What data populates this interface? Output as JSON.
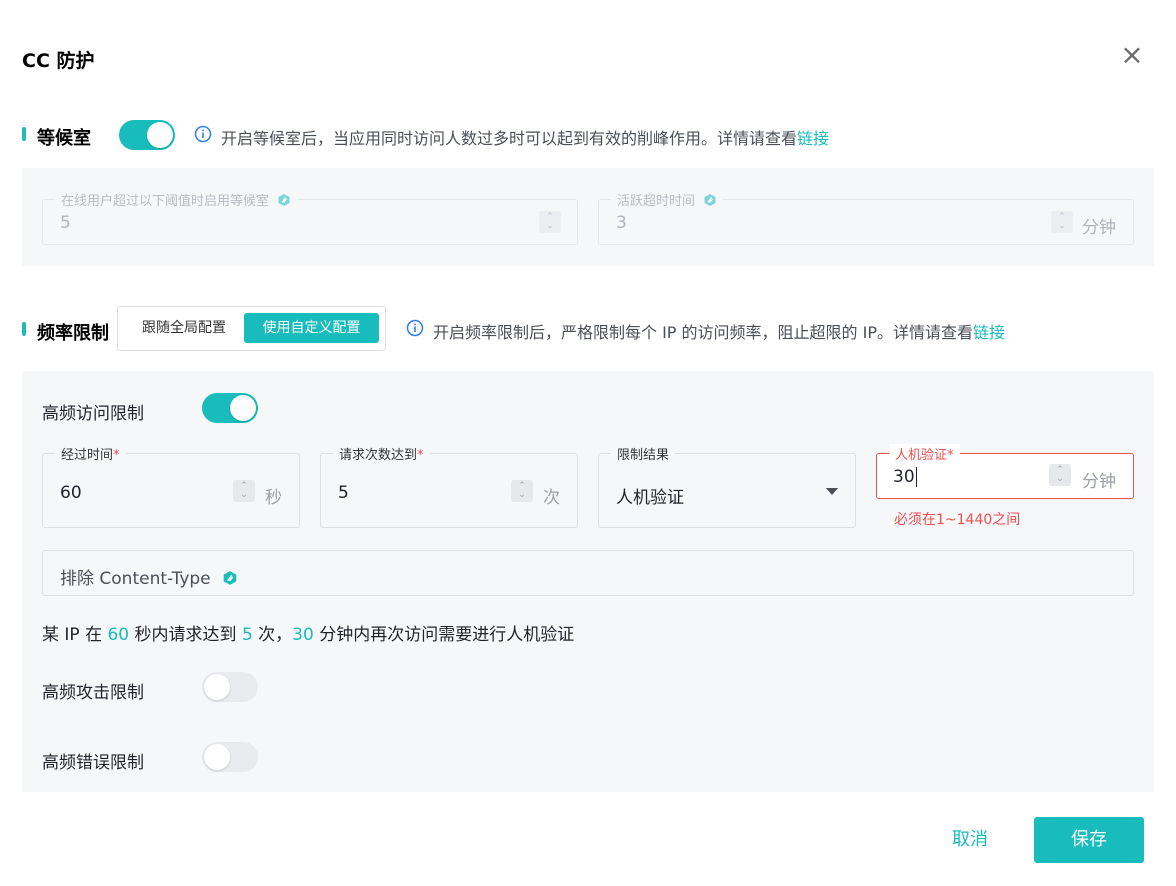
{
  "dialog": {
    "title": "CC 防护",
    "close_icon": "close-icon"
  },
  "waiting_room": {
    "title": "等候室",
    "enabled": true,
    "info_text": "开启等候室后，当应用同时访问人数过多时可以起到有效的削峰作用。详情请查看",
    "info_link": "链接",
    "threshold": {
      "label": "在线用户超过以下阈值时启用等候室",
      "value": "5",
      "disabled": true
    },
    "timeout": {
      "label": "活跃超时时间",
      "value": "3",
      "unit": "分钟",
      "disabled": true
    }
  },
  "rate_limit": {
    "title": "频率限制",
    "segments": [
      {
        "label": "跟随全局配置",
        "active": false
      },
      {
        "label": "使用自定义配置",
        "active": true
      }
    ],
    "info_text": "开启频率限制后，严格限制每个 IP 的访问频率，阻止超限的 IP。详情请查看",
    "info_link": "链接",
    "high_freq_access": {
      "label": "高频访问限制",
      "enabled": true
    },
    "fields": {
      "elapsed_time": {
        "label": "经过时间",
        "required": "*",
        "value": "60",
        "unit": "秒"
      },
      "request_count": {
        "label": "请求次数达到",
        "required": "*",
        "value": "5",
        "unit": "次"
      },
      "limit_result": {
        "label": "限制结果",
        "value": "人机验证"
      },
      "captcha": {
        "label": "人机验证",
        "required": "*",
        "value": "30",
        "unit": "分钟",
        "error": "必须在1~1440之间"
      }
    },
    "exclude_content_type": {
      "placeholder": "排除 Content-Type"
    },
    "summary": {
      "p1": "某 IP 在 ",
      "seconds": "60",
      "p2": " 秒内请求达到 ",
      "count": "5",
      "p3": " 次，",
      "minutes": "30",
      "p4": " 分钟内再次访问需要进行人机验证"
    },
    "high_freq_attack": {
      "label": "高频攻击限制",
      "enabled": false
    },
    "high_freq_error": {
      "label": "高频错误限制",
      "enabled": false
    }
  },
  "footer": {
    "cancel_label": "取消",
    "save_label": "保存"
  },
  "colors": {
    "accent": "#18bcbc",
    "error": "#ee4e4e",
    "panel_bg": "#f6f7f9"
  }
}
